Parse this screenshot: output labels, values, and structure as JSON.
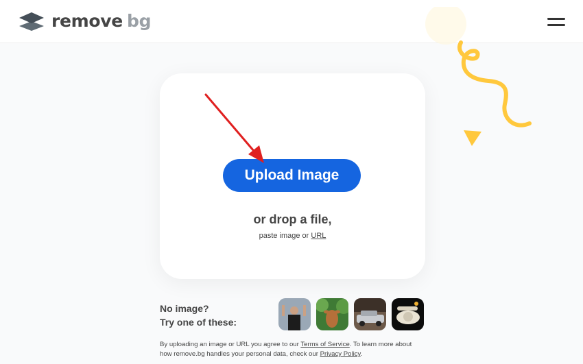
{
  "header": {
    "logo_part1": "remove",
    "logo_part2": "bg"
  },
  "upload": {
    "button_label": "Upload Image",
    "drop_text": "or drop a file,",
    "paste_prefix": "paste image or",
    "url_link": "URL"
  },
  "samples": {
    "label_line1": "No image?",
    "label_line2": "Try one of these:",
    "items": [
      "person-sample-icon",
      "animal-sample-icon",
      "car-sample-icon",
      "phone-sample-icon"
    ]
  },
  "legal": {
    "text1": "By uploading an image or URL you agree to our",
    "terms_link": "Terms of Service",
    "text2": ". To learn more about how remove.bg handles your personal data, check our",
    "privacy_link": "Privacy Policy",
    "text3": "."
  },
  "colors": {
    "accent": "#1565e0",
    "decoration": "#ffc83d",
    "annotation_arrow": "#e02020"
  }
}
